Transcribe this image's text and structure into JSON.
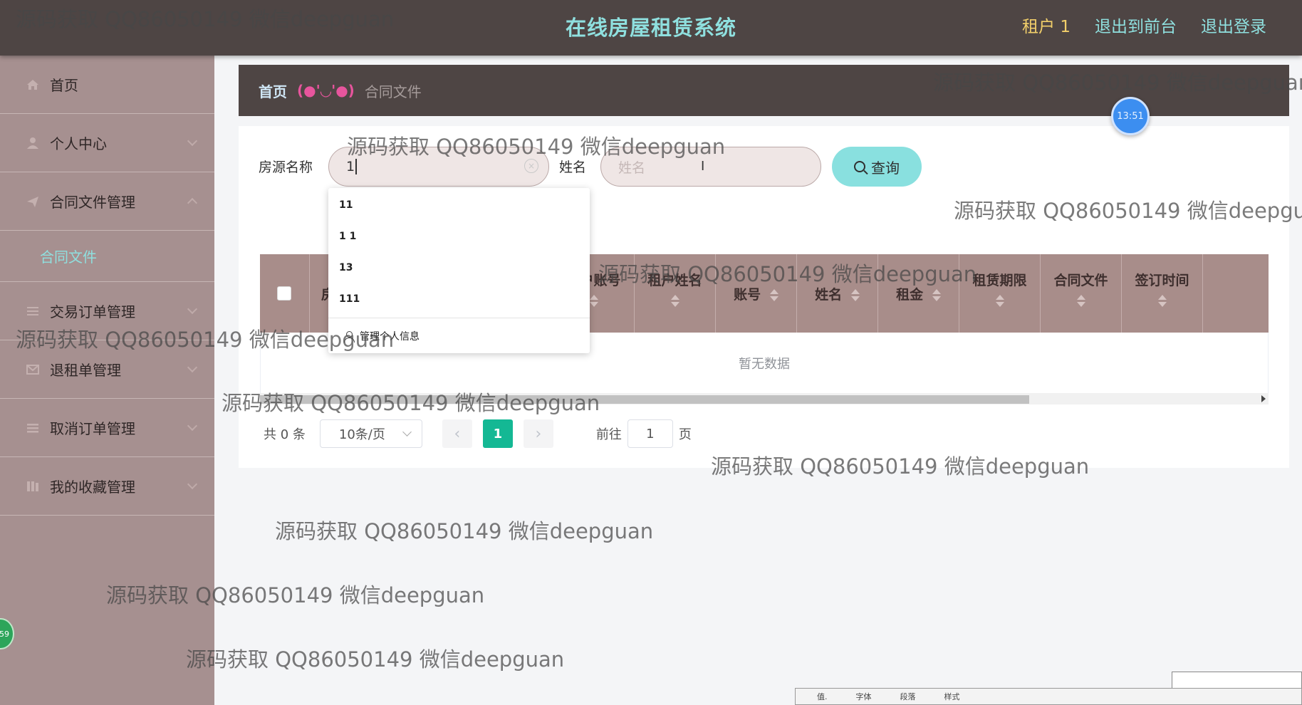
{
  "header": {
    "title": "在线房屋租赁系统",
    "user": "租户 1",
    "back_to_front": "退出到前台",
    "logout": "退出登录"
  },
  "sidebar": {
    "items": [
      {
        "label": "首页",
        "icon": "home-icon"
      },
      {
        "label": "个人中心",
        "icon": "user-icon"
      },
      {
        "label": "合同文件管理",
        "icon": "send-icon",
        "expanded": true
      },
      {
        "label": "交易订单管理",
        "icon": "list-icon"
      },
      {
        "label": "退租单管理",
        "icon": "mail-icon"
      },
      {
        "label": "取消订单管理",
        "icon": "menu-icon"
      },
      {
        "label": "我的收藏管理",
        "icon": "collection-icon"
      }
    ],
    "sub_item": "合同文件"
  },
  "breadcrumb": {
    "home": "首页",
    "face": "(●'◡'●)",
    "current": "合同文件"
  },
  "clock": "13:51",
  "search": {
    "house_label": "房源名称",
    "house_value": "1",
    "name_label": "姓名",
    "name_placeholder": "姓名",
    "button": "查询"
  },
  "autocomplete": {
    "items": [
      "11",
      "1 1",
      "13",
      "111"
    ],
    "manage": "管理个人信息"
  },
  "table": {
    "columns": [
      "房",
      "租户账号",
      "租户姓名",
      "账号",
      "姓名",
      "租金",
      "租赁期限",
      "合同文件",
      "签订时间"
    ],
    "empty_text": "暂无数据"
  },
  "pagination": {
    "total": "共 0 条",
    "page_size": "10条/页",
    "current_page": "1",
    "goto_label": "前往",
    "goto_value": "1",
    "page_suffix": "页"
  },
  "watermark": "源码获取 QQ86050149 微信deepguan",
  "green_badge": "59",
  "taskbar": [
    "值.",
    "字体",
    "段落",
    "样式"
  ],
  "colors": {
    "header_bg": "#4e4544",
    "sidebar_bg": "#a69090",
    "accent_cyan": "#8fe0df",
    "user_gold": "#f2cf6a",
    "table_head": "#a88d8a",
    "page_active": "#14b894"
  }
}
